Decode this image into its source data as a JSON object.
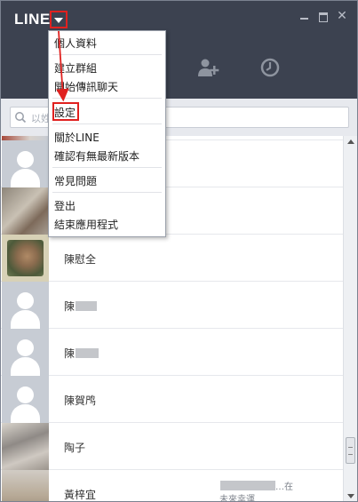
{
  "app": {
    "logo": "LINE"
  },
  "colors": {
    "titlebar": "#3c4250",
    "highlight": "#e0211f",
    "avatar_bg": "#c7ccd4"
  },
  "icons": {
    "dropdown": "caret-down-icon",
    "minimize": "minimize-icon",
    "maximize": "maximize-icon",
    "close": "close-icon",
    "add_friend": "add-friend-icon",
    "history": "clock-icon",
    "search": "search-icon"
  },
  "search": {
    "placeholder": "以姓"
  },
  "menu": {
    "items": [
      {
        "label": "個人資料"
      },
      {
        "label": "建立群組"
      },
      {
        "label": "開始傳訊聊天"
      },
      {
        "label": "設定"
      },
      {
        "label": "關於LINE"
      },
      {
        "label": "確認有無最新版本"
      },
      {
        "label": "常見問題"
      },
      {
        "label": "登出"
      },
      {
        "label": "結束應用程式"
      }
    ]
  },
  "contacts": [
    {
      "name": ""
    },
    {
      "name": ""
    },
    {
      "name": "陳慰全"
    },
    {
      "name": "陳"
    },
    {
      "name": "陳"
    },
    {
      "name": "陳賀鸤"
    },
    {
      "name": "陶子"
    },
    {
      "name": "黃梓宜",
      "status_line1": "…在",
      "status_line2": "未來幸運"
    }
  ]
}
